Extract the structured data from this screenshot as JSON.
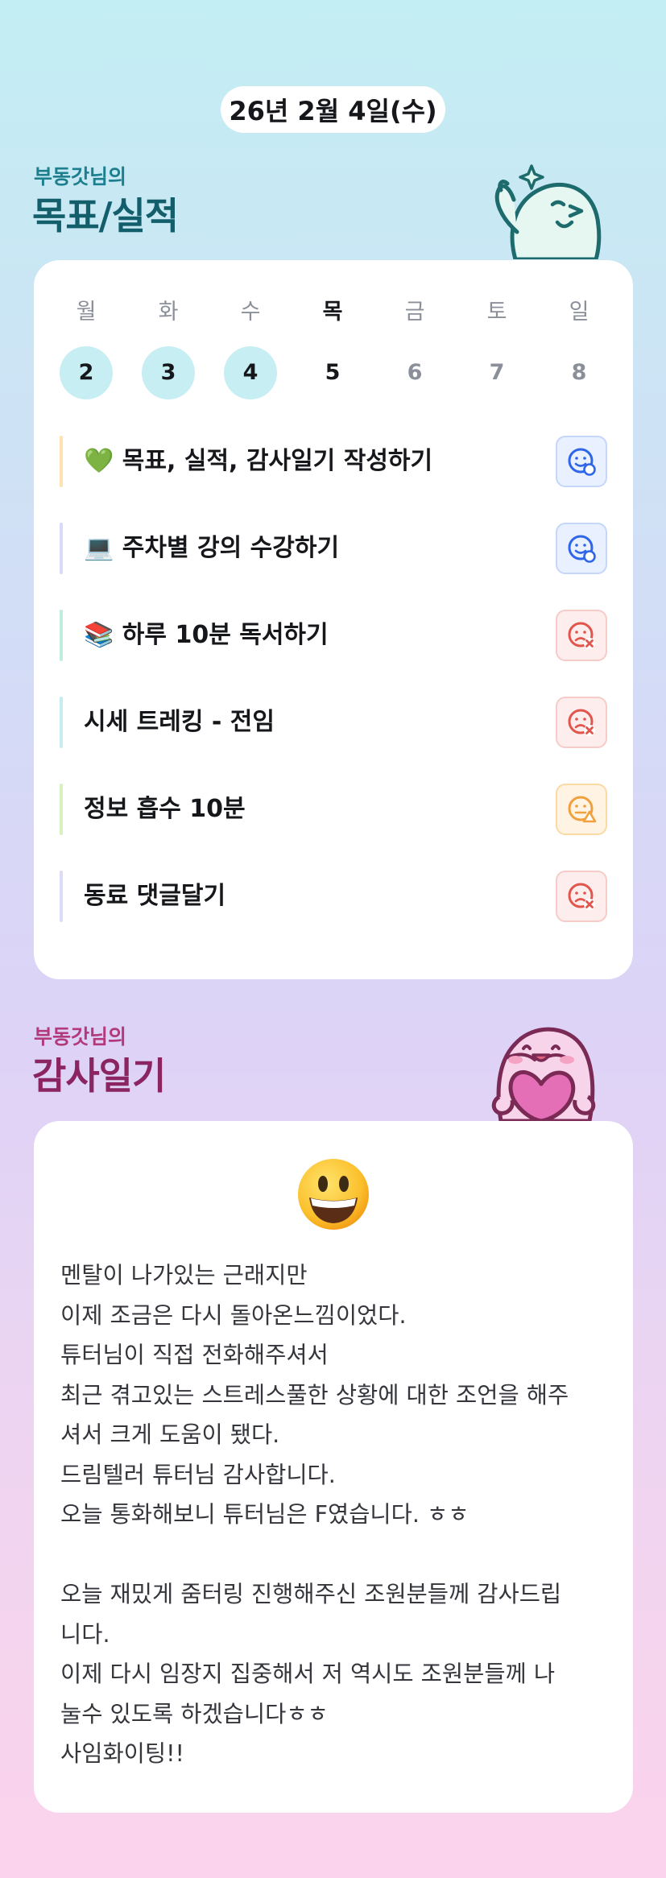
{
  "date_label": "26년 2월 4일(수)",
  "goals_section": {
    "owner": "부동갓님의",
    "title": "목표/실적"
  },
  "week": {
    "labels": [
      "월",
      "화",
      "수",
      "목",
      "금",
      "토",
      "일"
    ],
    "days": [
      "2",
      "3",
      "4",
      "5",
      "6",
      "7",
      "8"
    ],
    "completed_days": [
      "2",
      "3",
      "4"
    ],
    "today": "5"
  },
  "goals": [
    {
      "text": "💚 목표, 실적, 감사일기 작성하기",
      "status": "done",
      "accent": "#ffe2b0"
    },
    {
      "text": "💻 주차별 강의 수강하기",
      "status": "done",
      "accent": "#d6dcf8"
    },
    {
      "text": "📚 하루 10분 독서하기",
      "status": "fail",
      "accent": "#bfeedd"
    },
    {
      "text": "시세 트레킹 - 전임",
      "status": "fail",
      "accent": "#c7ecf3"
    },
    {
      "text": "정보 흡수 10분",
      "status": "partial",
      "accent": "#d5f2bf"
    },
    {
      "text": "동료 댓글달기",
      "status": "fail",
      "accent": "#dcdcf7"
    }
  ],
  "status_colors": {
    "done": {
      "bg": "#e9f0ff",
      "border": "#c5d6fb",
      "fg": "#2f66e8"
    },
    "fail": {
      "bg": "#fdeeed",
      "border": "#f7cbc8",
      "fg": "#e2554c"
    },
    "partial": {
      "bg": "#fff4e3",
      "border": "#fbd9a3",
      "fg": "#f0a03c"
    }
  },
  "gratitude_section": {
    "owner": "부동갓님의",
    "title": "감사일기"
  },
  "diary": {
    "mood_icon": "grinning-face-emoji",
    "text": "멘탈이 나가있는 근래지만\n이제 조금은 다시 돌아온느낌이었다.\n튜터님이 직접 전화해주셔서\n최근 겪고있는 스트레스풀한 상황에 대한 조언을 해주\n셔서 크게 도움이 됐다.\n드림텔러 튜터님 감사합니다.\n오늘 통화해보니 튜터님은 F였습니다. ㅎㅎ\n\n오늘 재밌게 줌터링 진행해주신 조원분들께 감사드립\n니다.\n이제 다시 임장지 집중해서 저 역시도 조원분들께 나\n눌수 있도록 하겠습니다ㅎㅎ\n사임화이팅!!"
  }
}
